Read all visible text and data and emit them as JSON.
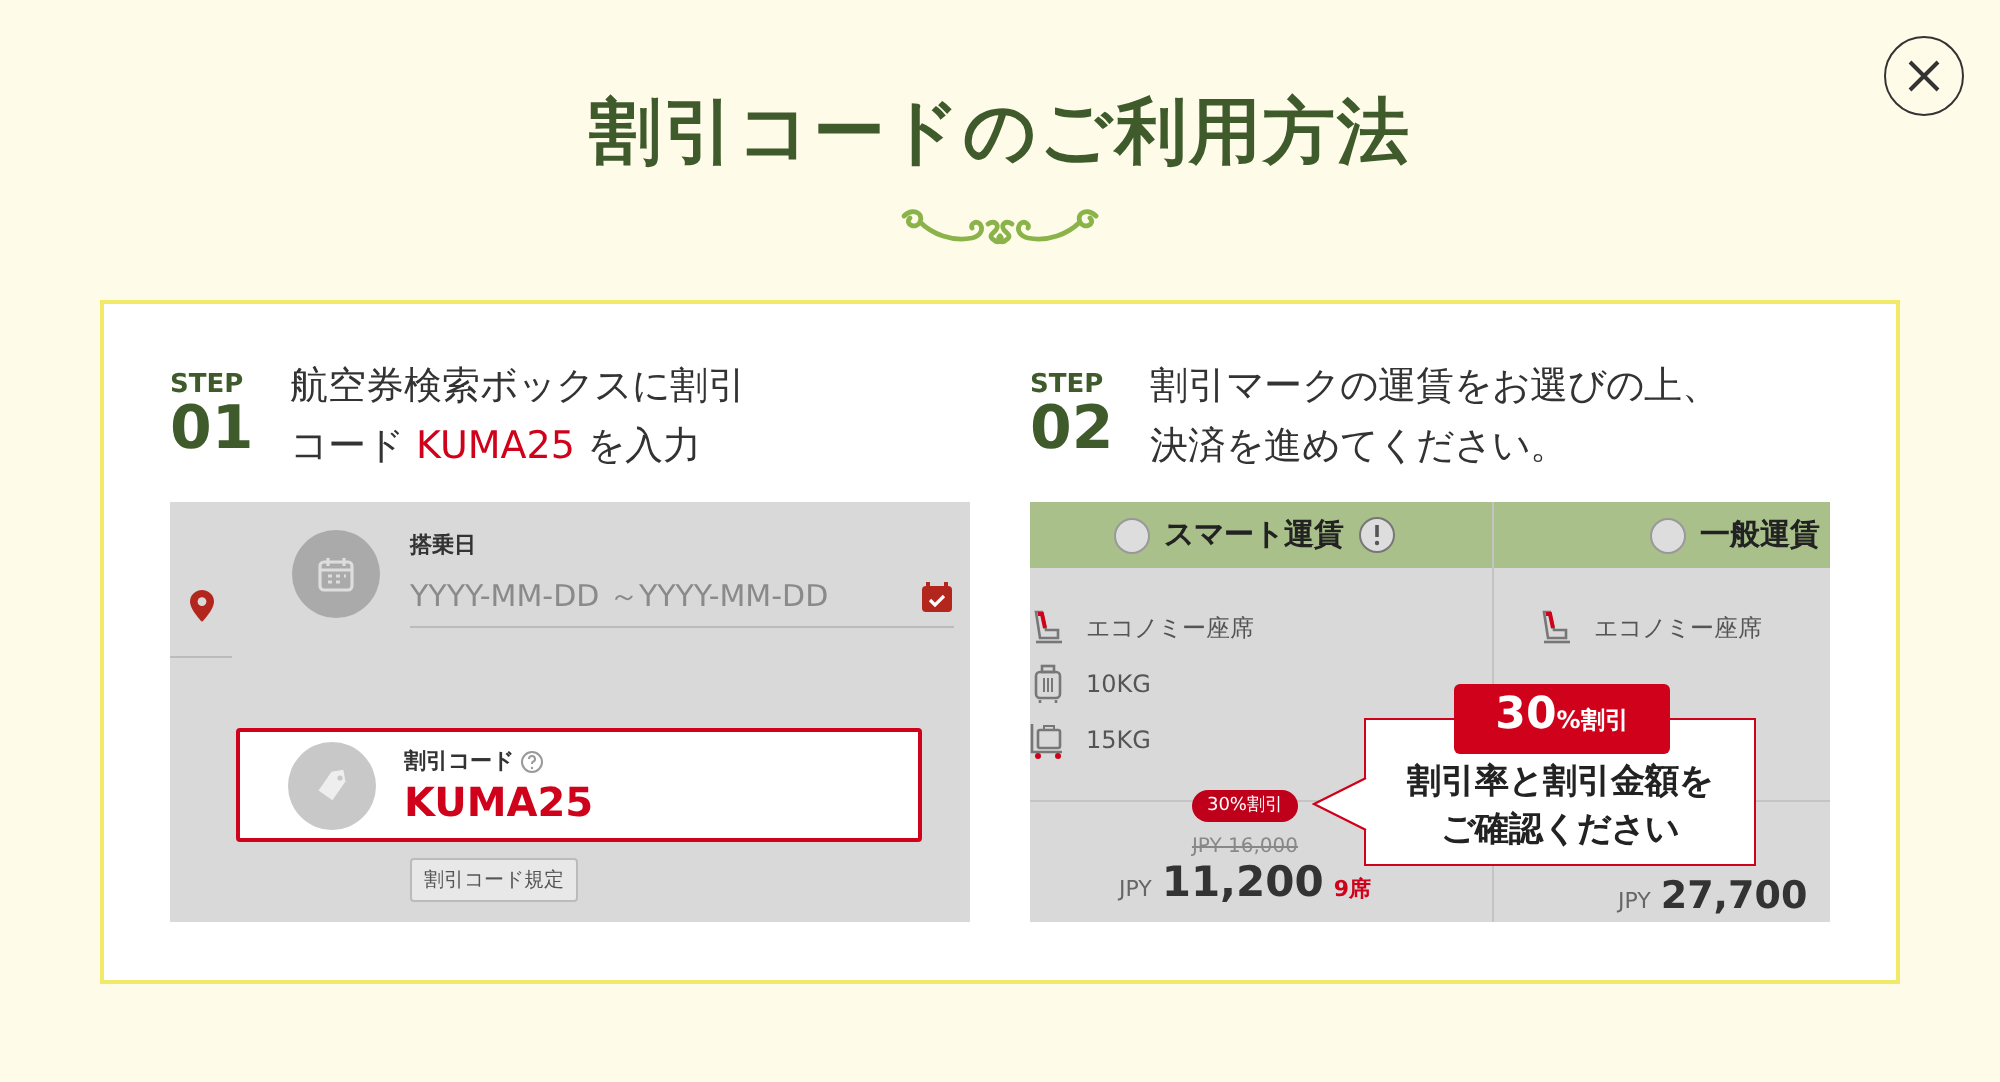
{
  "title": "割引コードのご利用方法",
  "steps": [
    {
      "kind": "search",
      "step_label": "STEP",
      "step_number": "01",
      "instruction_lines": [
        [
          {
            "text": "航空券検索ボックスに割引",
            "highlight": false
          }
        ],
        [
          {
            "text": "コード ",
            "highlight": false
          },
          {
            "text": "KUMA25",
            "highlight": true
          },
          {
            "text": " を入力",
            "highlight": false
          }
        ]
      ],
      "screen": {
        "date_label": "搭乗日",
        "date_placeholder": "YYYY-MM-DD ～YYYY-MM-DD",
        "code_label": "割引コード",
        "code_value": "KUMA25",
        "rules_button": "割引コード規定"
      }
    },
    {
      "kind": "fares",
      "step_label": "STEP",
      "step_number": "02",
      "instruction_lines": [
        [
          {
            "text": "割引マークの運賃をお選びの上、",
            "highlight": false
          }
        ],
        [
          {
            "text": "決済を進めてください。",
            "highlight": false
          }
        ]
      ],
      "screen": {
        "columns": [
          {
            "name": "スマート運賃",
            "selected": false,
            "features": [
              {
                "kind": "seat",
                "text": "エコノミー座席"
              },
              {
                "kind": "carry-on",
                "text": "10KG"
              },
              {
                "kind": "checked-bag",
                "text": "15KG"
              }
            ],
            "discount": "30%割引",
            "old_price": "JPY 16,000",
            "currency": "JPY",
            "price": "11,200",
            "seats": "9席"
          },
          {
            "name": "一般運賃",
            "selected": false,
            "features": [
              {
                "kind": "seat",
                "text": "エコノミー座席"
              }
            ],
            "currency": "JPY",
            "price": "27,700"
          }
        ],
        "callout": {
          "badge_figure": "30",
          "badge_suffix": "%割引",
          "lines": [
            "割引率と割引金額を",
            "ご確認ください"
          ]
        }
      }
    }
  ]
}
